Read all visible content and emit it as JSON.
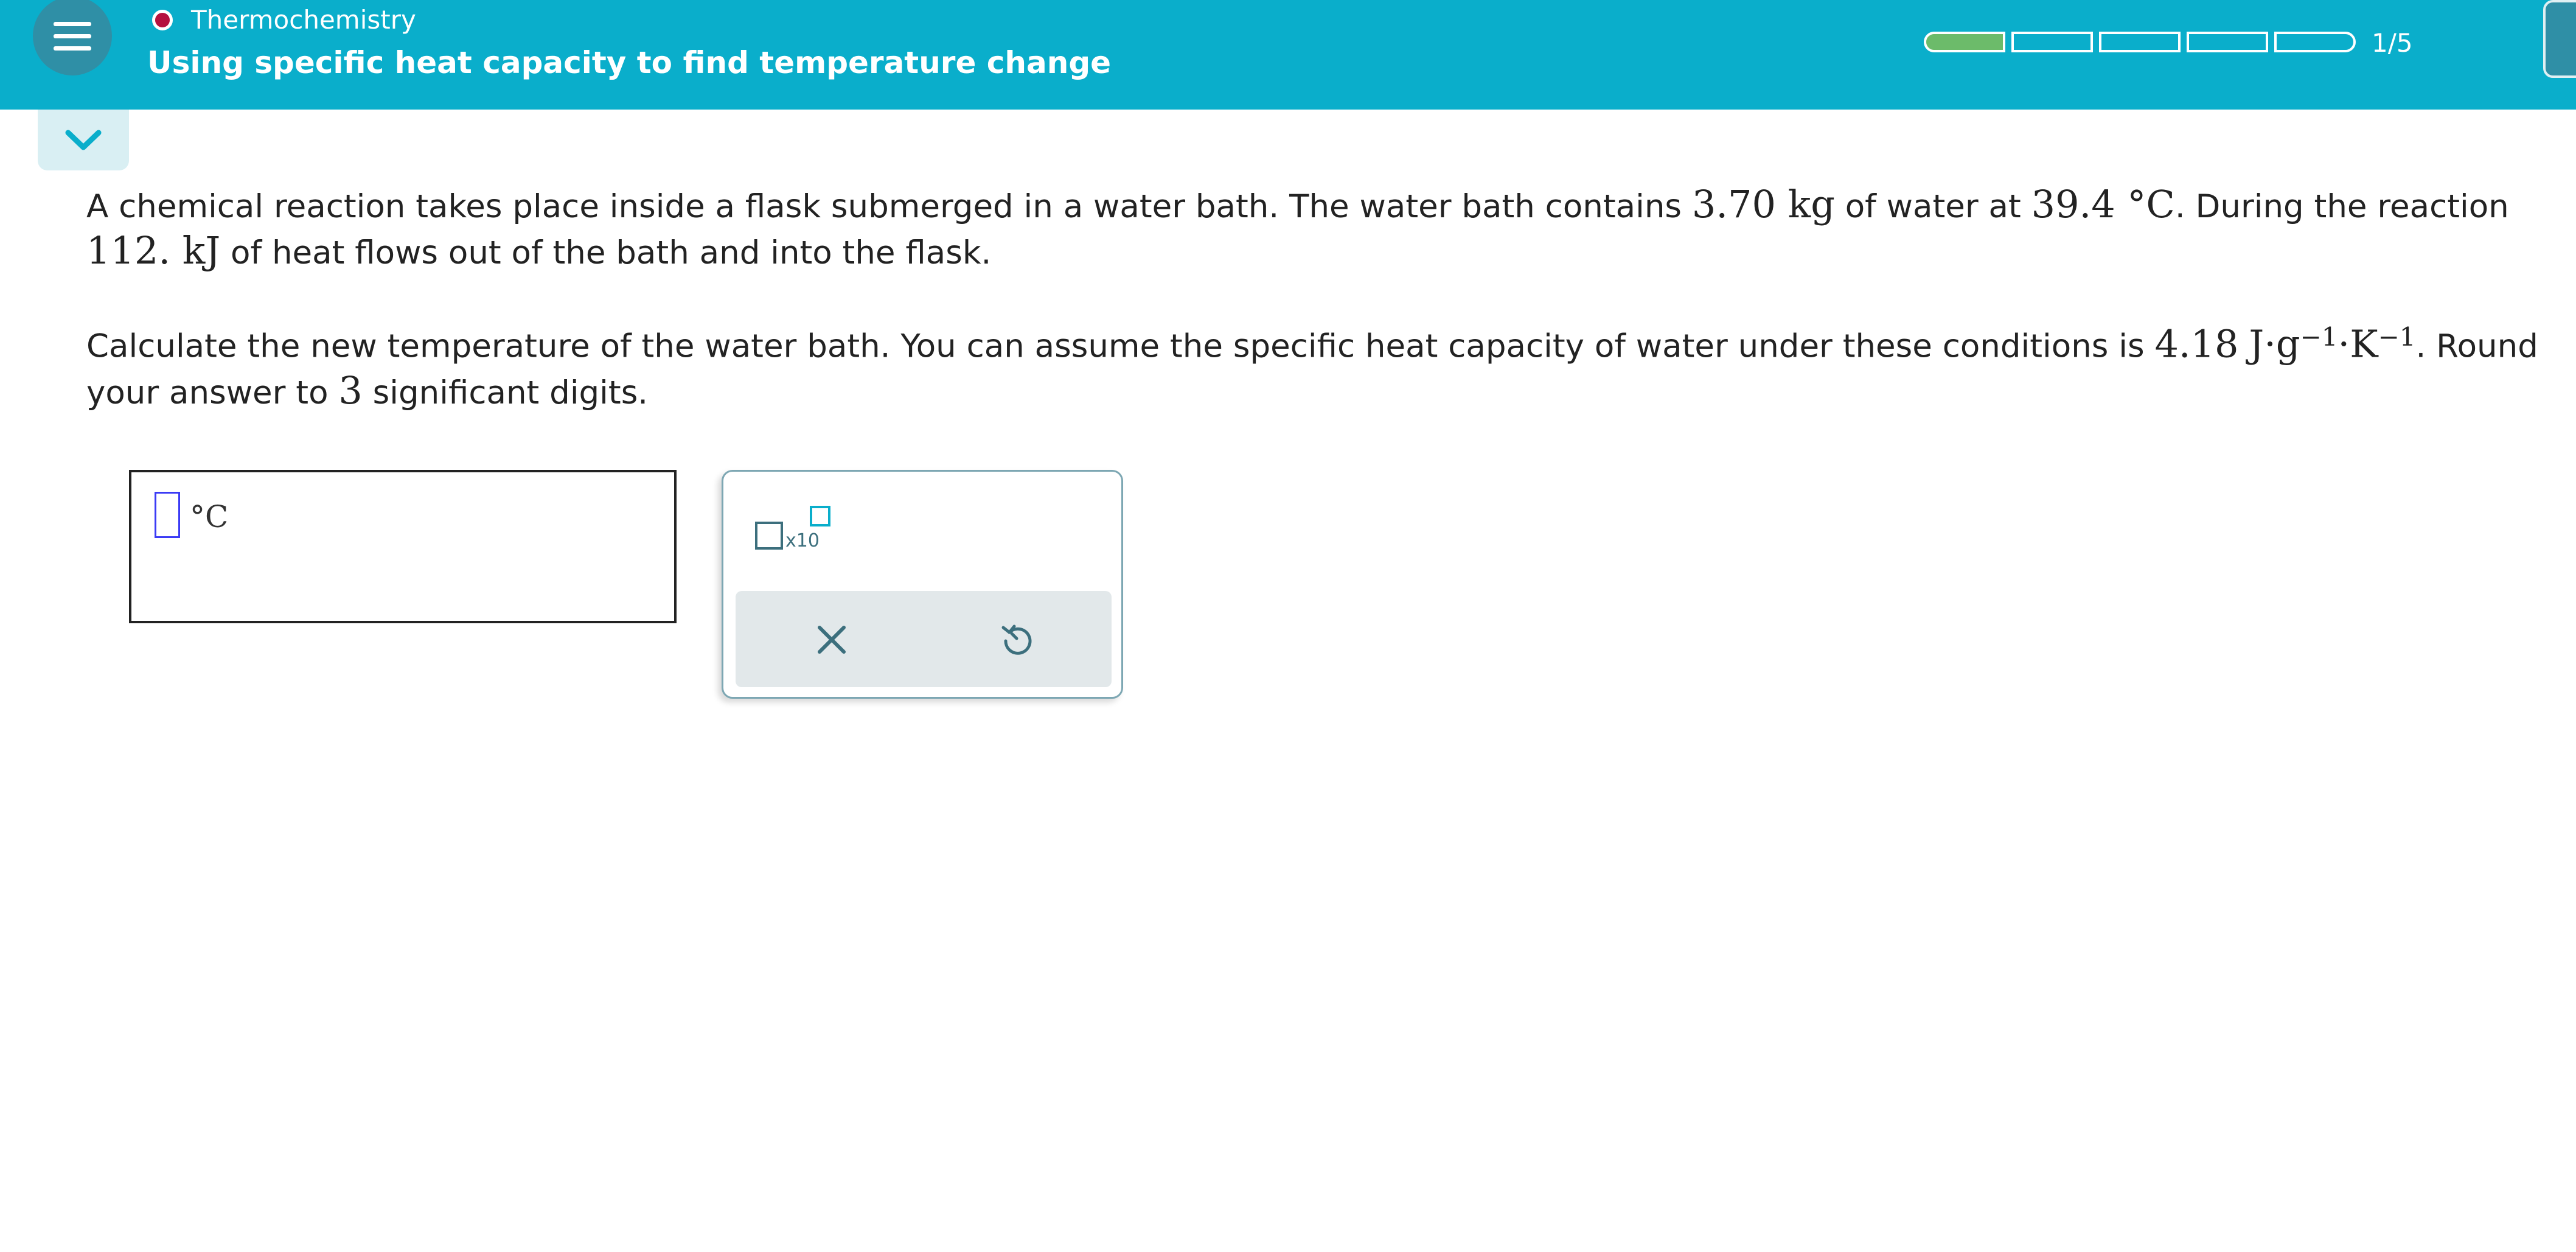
{
  "header": {
    "topic": "Thermochemistry",
    "title": "Using specific heat capacity to find temperature change",
    "progress": {
      "completed": 1,
      "total": 5,
      "label": "1/5"
    },
    "colors": {
      "bar": "#0aaecb",
      "topic_dot": "#b5123f",
      "progress_fill": "#6cbb6a"
    }
  },
  "icons": {
    "menu": "hamburger-menu-icon",
    "collapse": "chevron-down-icon",
    "clear": "close-x-icon",
    "undo": "undo-icon",
    "sci": "scientific-notation-icon"
  },
  "question": {
    "p1": {
      "t1": "A chemical reaction takes place inside a flask submerged in a water bath. The water bath contains ",
      "mass": "3.70 kg",
      "t2": " of water at ",
      "temp": "39.4 °C",
      "t3": ". During the reaction ",
      "heat": "112. kJ",
      "t4": " of heat flows out of the bath and into the flask."
    },
    "p2": {
      "t1": "Calculate the new temperature of the water bath. You can assume the specific heat capacity of water under these conditions is ",
      "cval": "4.18",
      "cunit_a": "J·g",
      "exp1": "−1",
      "cunit_b": "·K",
      "exp2": "−1",
      "t2": ". Round your answer to ",
      "sig": "3",
      "t3": " significant digits."
    }
  },
  "answer": {
    "value": "",
    "unit": "°C"
  },
  "tools": {
    "sci_label": "x10"
  }
}
